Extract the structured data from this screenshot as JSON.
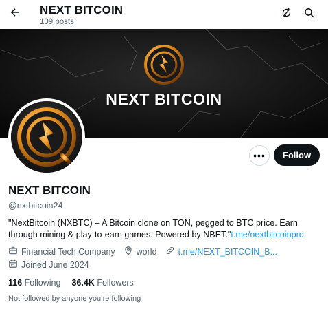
{
  "header": {
    "title": "NEXT BITCOIN",
    "posts": "109 posts",
    "back_icon": "arrow-left-icon",
    "refresh_icon": "refresh-icon",
    "search_icon": "search-icon"
  },
  "banner": {
    "text": "NEXT BITCOIN",
    "logo_icon": "next-bitcoin-logo",
    "background": "black-marble"
  },
  "profile": {
    "name": "NEXT BITCOIN",
    "handle": "@nxtbitcoin24",
    "more_label": "•••",
    "follow_label": "Follow",
    "bio_text": "\"NextBitcoin (NXBTC) – A Bitcoin clone on TON, pegged to BTC price. Earn through mining & play-to-earn games. Powered by NBET.\"",
    "bio_link": "t.me/nextbitcoinpro",
    "category": "Financial Tech Company",
    "location": "world",
    "website": "t.me/NEXT_BITCOIN_B...",
    "joined": "Joined June 2024",
    "following_count": "116",
    "following_label": "Following",
    "followers_count": "36.4K",
    "followers_label": "Followers",
    "not_followed_text": "Not followed by anyone you’re following"
  },
  "colors": {
    "accent": "#1d9bf0",
    "text": "#0f1419",
    "secondary": "#536471",
    "gold": "#e8a33a"
  }
}
